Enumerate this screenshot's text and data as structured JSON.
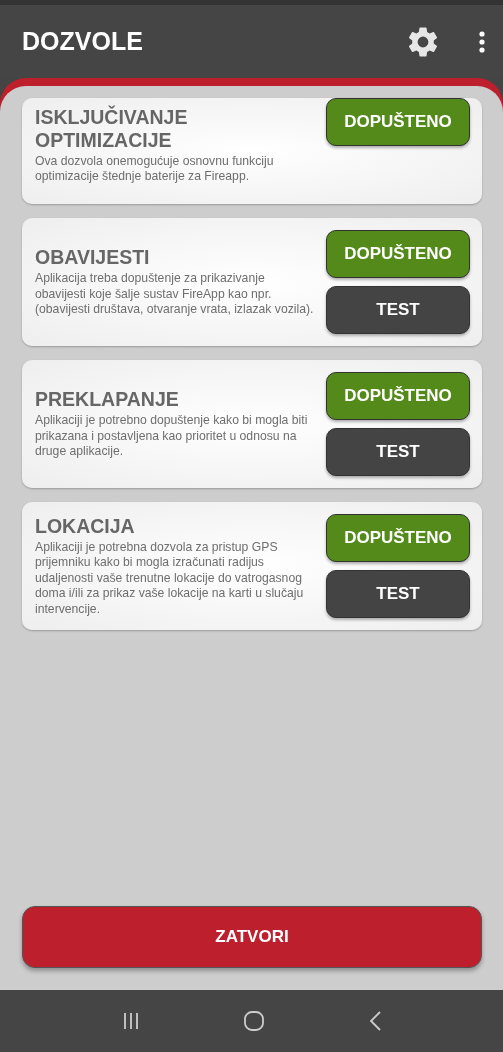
{
  "app_bar": {
    "title": "DOZVOLE"
  },
  "permissions": [
    {
      "title": "ISKLJUČIVANJE OPTIMIZACIJE",
      "description": "Ova dozvola onemogućuje osnovnu funkciju optimizacije štednje baterije za Fireapp.",
      "status_button": "DOPUŠTENO",
      "granted": true
    },
    {
      "title": "OBAVIJESTI",
      "description": "Aplikacija treba dopuštenje za prikazivanje obavijesti koje šalje sustav FireApp kao npr. (obavijesti društava, otvaranje vrata, izlazak vozila).",
      "status_button": "DOPUŠTENO",
      "granted": true,
      "test_button": "TEST"
    },
    {
      "title": "PREKLAPANJE",
      "description": "Aplikaciji je potrebno dopuštenje kako bi mogla biti prikazana i postavljena kao prioritet u odnosu na druge aplikacije.",
      "status_button": "DOPUŠTENO",
      "granted": true,
      "test_button": "TEST"
    },
    {
      "title": "LOKACIJA",
      "description": "Aplikaciji je potrebna dozvola za pristup GPS prijemniku kako bi mogla izračunati radijus udaljenosti vaše trenutne lokacije do vatrogasnog doma i/ili za prikaz vaše lokacije na karti u slučaju intervencije.",
      "status_button": "DOPUŠTENO",
      "granted": true,
      "test_button": "TEST"
    }
  ],
  "close_button": "ZATVORI"
}
